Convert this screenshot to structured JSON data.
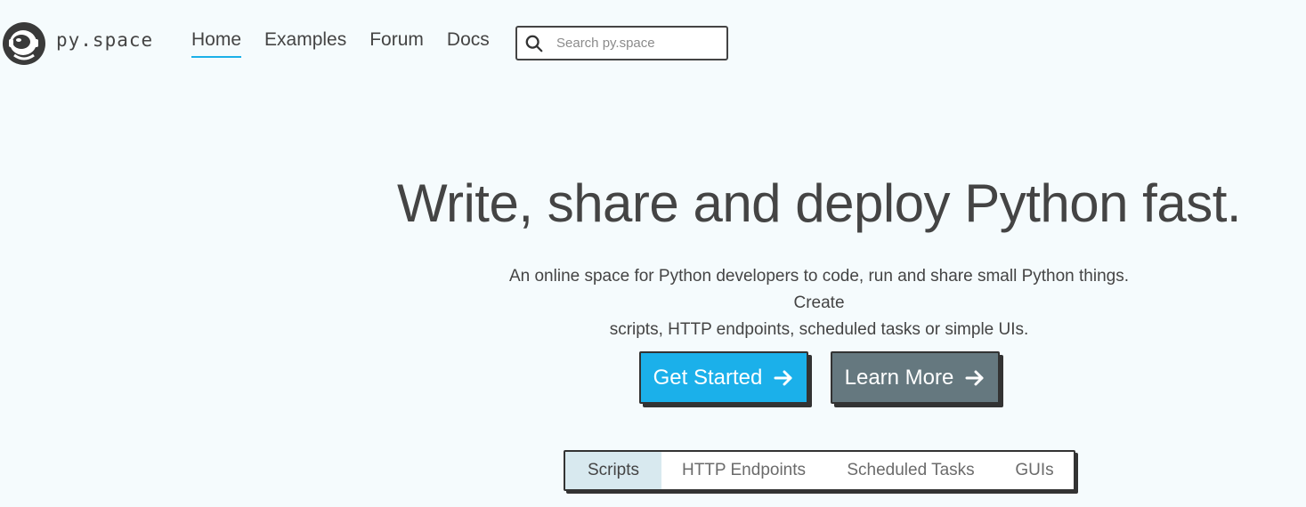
{
  "header": {
    "brand": "py.space",
    "nav": [
      {
        "label": "Home",
        "active": true
      },
      {
        "label": "Examples",
        "active": false
      },
      {
        "label": "Forum",
        "active": false
      },
      {
        "label": "Docs",
        "active": false
      }
    ],
    "search": {
      "placeholder": "Search py.space",
      "value": ""
    }
  },
  "hero": {
    "title": "Write, share and deploy Python fast.",
    "subtitle_line1": "An online space for Python developers to code, run and share small Python things. Create",
    "subtitle_line2": "scripts, HTTP endpoints, scheduled tasks or simple UIs.",
    "primary_button": "Get Started",
    "secondary_button": "Learn More"
  },
  "tabs": [
    {
      "label": "Scripts",
      "active": true
    },
    {
      "label": "HTTP Endpoints",
      "active": false
    },
    {
      "label": "Scheduled Tasks",
      "active": false
    },
    {
      "label": "GUIs",
      "active": false
    }
  ],
  "colors": {
    "background": "#f5fbfd",
    "primary": "#1bb0ea",
    "secondary": "#65787f",
    "accent_underline": "#1bb0e8",
    "active_tab": "#d8e9ef"
  },
  "icons": {
    "logo": "astronaut-helmet-logo",
    "search": "search-icon",
    "arrow": "arrow-right-icon"
  }
}
